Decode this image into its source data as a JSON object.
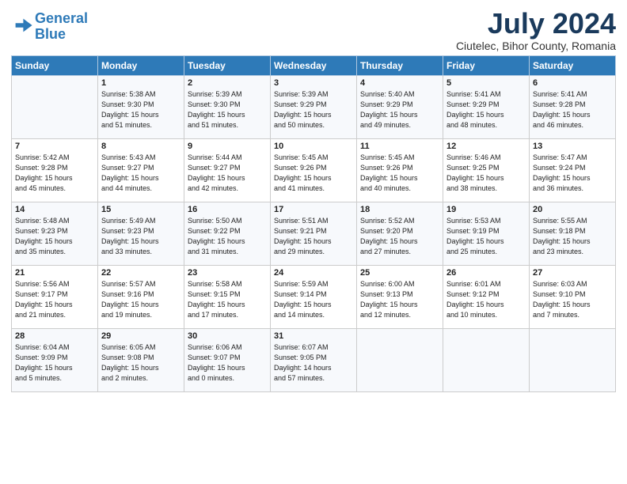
{
  "header": {
    "logo_line1": "General",
    "logo_line2": "Blue",
    "month_year": "July 2024",
    "location": "Ciutelec, Bihor County, Romania"
  },
  "weekdays": [
    "Sunday",
    "Monday",
    "Tuesday",
    "Wednesday",
    "Thursday",
    "Friday",
    "Saturday"
  ],
  "weeks": [
    [
      {
        "day": "",
        "content": ""
      },
      {
        "day": "1",
        "content": "Sunrise: 5:38 AM\nSunset: 9:30 PM\nDaylight: 15 hours\nand 51 minutes."
      },
      {
        "day": "2",
        "content": "Sunrise: 5:39 AM\nSunset: 9:30 PM\nDaylight: 15 hours\nand 51 minutes."
      },
      {
        "day": "3",
        "content": "Sunrise: 5:39 AM\nSunset: 9:29 PM\nDaylight: 15 hours\nand 50 minutes."
      },
      {
        "day": "4",
        "content": "Sunrise: 5:40 AM\nSunset: 9:29 PM\nDaylight: 15 hours\nand 49 minutes."
      },
      {
        "day": "5",
        "content": "Sunrise: 5:41 AM\nSunset: 9:29 PM\nDaylight: 15 hours\nand 48 minutes."
      },
      {
        "day": "6",
        "content": "Sunrise: 5:41 AM\nSunset: 9:28 PM\nDaylight: 15 hours\nand 46 minutes."
      }
    ],
    [
      {
        "day": "7",
        "content": "Sunrise: 5:42 AM\nSunset: 9:28 PM\nDaylight: 15 hours\nand 45 minutes."
      },
      {
        "day": "8",
        "content": "Sunrise: 5:43 AM\nSunset: 9:27 PM\nDaylight: 15 hours\nand 44 minutes."
      },
      {
        "day": "9",
        "content": "Sunrise: 5:44 AM\nSunset: 9:27 PM\nDaylight: 15 hours\nand 42 minutes."
      },
      {
        "day": "10",
        "content": "Sunrise: 5:45 AM\nSunset: 9:26 PM\nDaylight: 15 hours\nand 41 minutes."
      },
      {
        "day": "11",
        "content": "Sunrise: 5:45 AM\nSunset: 9:26 PM\nDaylight: 15 hours\nand 40 minutes."
      },
      {
        "day": "12",
        "content": "Sunrise: 5:46 AM\nSunset: 9:25 PM\nDaylight: 15 hours\nand 38 minutes."
      },
      {
        "day": "13",
        "content": "Sunrise: 5:47 AM\nSunset: 9:24 PM\nDaylight: 15 hours\nand 36 minutes."
      }
    ],
    [
      {
        "day": "14",
        "content": "Sunrise: 5:48 AM\nSunset: 9:23 PM\nDaylight: 15 hours\nand 35 minutes."
      },
      {
        "day": "15",
        "content": "Sunrise: 5:49 AM\nSunset: 9:23 PM\nDaylight: 15 hours\nand 33 minutes."
      },
      {
        "day": "16",
        "content": "Sunrise: 5:50 AM\nSunset: 9:22 PM\nDaylight: 15 hours\nand 31 minutes."
      },
      {
        "day": "17",
        "content": "Sunrise: 5:51 AM\nSunset: 9:21 PM\nDaylight: 15 hours\nand 29 minutes."
      },
      {
        "day": "18",
        "content": "Sunrise: 5:52 AM\nSunset: 9:20 PM\nDaylight: 15 hours\nand 27 minutes."
      },
      {
        "day": "19",
        "content": "Sunrise: 5:53 AM\nSunset: 9:19 PM\nDaylight: 15 hours\nand 25 minutes."
      },
      {
        "day": "20",
        "content": "Sunrise: 5:55 AM\nSunset: 9:18 PM\nDaylight: 15 hours\nand 23 minutes."
      }
    ],
    [
      {
        "day": "21",
        "content": "Sunrise: 5:56 AM\nSunset: 9:17 PM\nDaylight: 15 hours\nand 21 minutes."
      },
      {
        "day": "22",
        "content": "Sunrise: 5:57 AM\nSunset: 9:16 PM\nDaylight: 15 hours\nand 19 minutes."
      },
      {
        "day": "23",
        "content": "Sunrise: 5:58 AM\nSunset: 9:15 PM\nDaylight: 15 hours\nand 17 minutes."
      },
      {
        "day": "24",
        "content": "Sunrise: 5:59 AM\nSunset: 9:14 PM\nDaylight: 15 hours\nand 14 minutes."
      },
      {
        "day": "25",
        "content": "Sunrise: 6:00 AM\nSunset: 9:13 PM\nDaylight: 15 hours\nand 12 minutes."
      },
      {
        "day": "26",
        "content": "Sunrise: 6:01 AM\nSunset: 9:12 PM\nDaylight: 15 hours\nand 10 minutes."
      },
      {
        "day": "27",
        "content": "Sunrise: 6:03 AM\nSunset: 9:10 PM\nDaylight: 15 hours\nand 7 minutes."
      }
    ],
    [
      {
        "day": "28",
        "content": "Sunrise: 6:04 AM\nSunset: 9:09 PM\nDaylight: 15 hours\nand 5 minutes."
      },
      {
        "day": "29",
        "content": "Sunrise: 6:05 AM\nSunset: 9:08 PM\nDaylight: 15 hours\nand 2 minutes."
      },
      {
        "day": "30",
        "content": "Sunrise: 6:06 AM\nSunset: 9:07 PM\nDaylight: 15 hours\nand 0 minutes."
      },
      {
        "day": "31",
        "content": "Sunrise: 6:07 AM\nSunset: 9:05 PM\nDaylight: 14 hours\nand 57 minutes."
      },
      {
        "day": "",
        "content": ""
      },
      {
        "day": "",
        "content": ""
      },
      {
        "day": "",
        "content": ""
      }
    ]
  ]
}
